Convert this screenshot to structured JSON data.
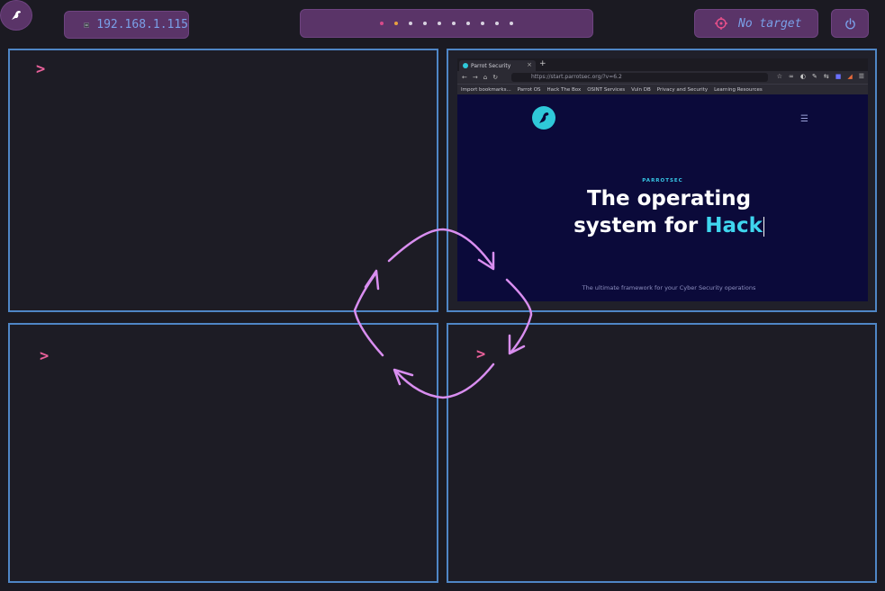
{
  "topbar": {
    "ip_address": "192.168.1.115",
    "workspace_dots": [
      "c1",
      "c2",
      "n",
      "n",
      "n",
      "n",
      "n",
      "n",
      "n",
      "n"
    ],
    "target_label": "No target",
    "accent_color": "#5a3468",
    "text_color": "#7aa0e8"
  },
  "panes": {
    "top_left_prompt": ">",
    "bottom_left_prompt": ">",
    "bottom_right_prompt": ">",
    "border_color": "#4f86c6"
  },
  "browser": {
    "tab_title": "Parrot Security",
    "tab_close": "×",
    "new_tab": "+",
    "url": "https://start.parrotsec.org/?v=6.2",
    "bookmarks": [
      "Import bookmarks...",
      "Parrot OS",
      "Hack The Box",
      "OSINT Services",
      "Vuln DB",
      "Privacy and Security",
      "Learning Resources"
    ],
    "brand_small": "PARROTSEC",
    "hero_line1": "The operating",
    "hero_line2_prefix": "system for ",
    "hero_line2_accent": "Hack",
    "tagline": "The ultimate framework for your Cyber Security operations"
  }
}
